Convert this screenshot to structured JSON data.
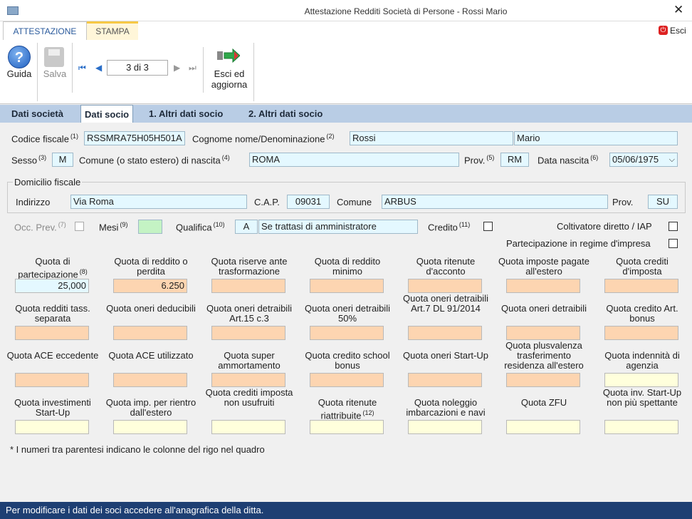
{
  "window": {
    "title": "Attestazione Redditi Società di Persone - Rossi Mario",
    "close": "✕"
  },
  "ribbon": {
    "tabs": [
      "ATTESTAZIONE",
      "STAMPA"
    ],
    "esci": "Esci",
    "guida": "Guida",
    "salva": "Salva",
    "record": "3 di 3",
    "esci_aggiorna": [
      "Esci ed",
      "aggiorna"
    ]
  },
  "subtabs": [
    "Dati società",
    "Dati socio",
    "1. Altri dati socio",
    "2. Altri dati socio"
  ],
  "socio": {
    "codice_fiscale_label": "Codice fiscale",
    "codice_fiscale_sup": "(1)",
    "codice_fiscale": "RSSMRA75H05H501A",
    "cognome_label": "Cognome nome/Denominazione",
    "cognome_sup": "(2)",
    "cognome": "Rossi",
    "nome": "Mario",
    "sesso_label": "Sesso",
    "sesso_sup": "(3)",
    "sesso": "M",
    "comune_nascita_label": "Comune (o stato estero) di nascita",
    "comune_nascita_sup": "(4)",
    "comune_nascita": "ROMA",
    "prov_label": "Prov.",
    "prov_sup": "(5)",
    "prov": "RM",
    "data_nascita_label": "Data nascita",
    "data_nascita_sup": "(6)",
    "data_nascita": "05/06/1975"
  },
  "domicilio": {
    "legend": "Domicilio fiscale",
    "indirizzo_label": "Indirizzo",
    "indirizzo": "Via Roma",
    "cap_label": "C.A.P.",
    "cap": "09031",
    "comune_label": "Comune",
    "comune": "ARBUS",
    "prov_label": "Prov.",
    "prov": "SU"
  },
  "extra": {
    "occ_prev_label": "Occ. Prev.",
    "occ_prev_sup": "(7)",
    "mesi_label": "Mesi",
    "mesi_sup": "(9)",
    "qualifica_label": "Qualifica",
    "qualifica_sup": "(10)",
    "qualifica_code": "A",
    "qualifica_desc": "Se trattasi di amministratore",
    "credito_label": "Credito",
    "credito_sup": "(11)",
    "coltivatore_label": "Coltivatore diretto / IAP",
    "partecipazione_label": "Partecipazione in regime d'impresa"
  },
  "quote": [
    {
      "label": "Quota di partecipazione",
      "sup": "(8)",
      "value": "25,000",
      "color": "b"
    },
    {
      "label": "Quota di reddito o perdita",
      "value": "6.250",
      "color": "o"
    },
    {
      "label": "Quota riserve ante trasformazione",
      "value": "",
      "color": "o"
    },
    {
      "label": "Quota di reddito minimo",
      "value": "",
      "color": "o"
    },
    {
      "label": "Quota ritenute d'acconto",
      "value": "",
      "color": "o"
    },
    {
      "label": "Quota imposte pagate all'estero",
      "value": "",
      "color": "o"
    },
    {
      "label": "Quota crediti d'imposta",
      "value": "",
      "color": "o"
    },
    {
      "label": "Quota redditi tass. separata",
      "value": "",
      "color": "o"
    },
    {
      "label": "Quota oneri deducibili",
      "value": "",
      "color": "o"
    },
    {
      "label": "Quota oneri detraibili Art.15 c.3",
      "value": "",
      "color": "o"
    },
    {
      "label": "Quota oneri detraibili 50%",
      "value": "",
      "color": "o"
    },
    {
      "label": "Quota oneri detraibili Art.7 DL 91/2014",
      "value": "",
      "color": "o"
    },
    {
      "label": "Quota oneri detraibili",
      "value": "",
      "color": "o"
    },
    {
      "label": "Quota credito Art. bonus",
      "value": "",
      "color": "o"
    },
    {
      "label": "Quota ACE eccedente",
      "value": "",
      "color": "o"
    },
    {
      "label": "Quota ACE utilizzato",
      "value": "",
      "color": "o"
    },
    {
      "label": "Quota super ammortamento",
      "value": "",
      "color": "o"
    },
    {
      "label": "Quota credito school bonus",
      "value": "",
      "color": "o"
    },
    {
      "label": "Quota oneri Start-Up",
      "value": "",
      "color": "o"
    },
    {
      "label": "Quota plusvalenza trasferimento residenza all'estero",
      "value": "",
      "color": "o"
    },
    {
      "label": "Quota indennità di agenzia",
      "value": "",
      "color": "y"
    },
    {
      "label": "Quota investimenti Start-Up",
      "value": "",
      "color": "y"
    },
    {
      "label": "Quota imp. per rientro dall'estero",
      "value": "",
      "color": "y"
    },
    {
      "label": "Quota crediti imposta non usufruiti",
      "value": "",
      "color": "y"
    },
    {
      "label": "Quota ritenute riattribuite",
      "sup": "(12)",
      "value": "",
      "color": "y"
    },
    {
      "label": "Quota noleggio imbarcazioni e navi",
      "value": "",
      "color": "y"
    },
    {
      "label": "Quota ZFU",
      "value": "",
      "color": "y"
    },
    {
      "label": "Quota inv. Start-Up non più spettante",
      "value": "",
      "color": "y"
    }
  ],
  "note": "* I numeri tra parentesi indicano le colonne del rigo nel quadro",
  "status": "Per modificare i dati dei soci accedere all'anagrafica della ditta."
}
